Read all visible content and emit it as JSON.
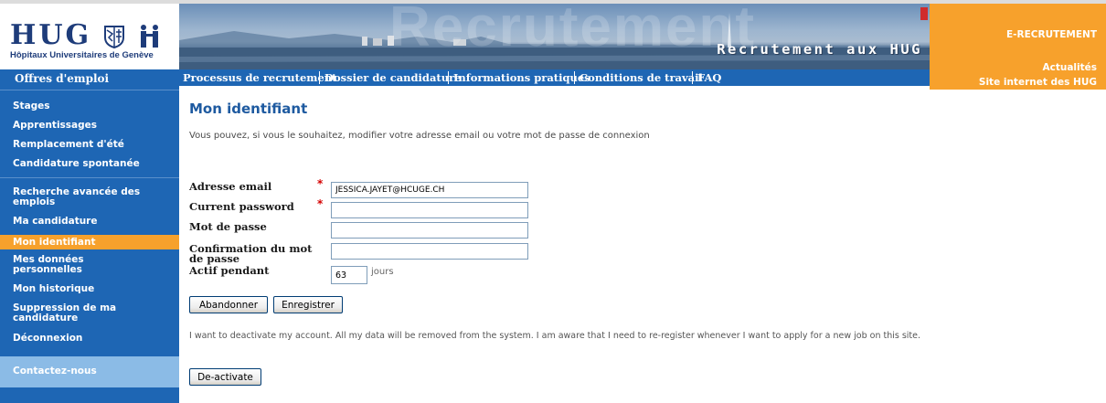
{
  "header": {
    "logo_word": "HUG",
    "logo_subtitle": "Hôpitaux Universitaires de Genève",
    "banner_ghost": "Recrutement",
    "banner_title": "Recrutement aux HUG",
    "right_links": {
      "erecrutement": "E-RECRUTEMENT",
      "actualites": "Actualités",
      "site": "Site internet des HUG"
    },
    "accent_color": "#f7a12c",
    "nav_color": "#1e66b4"
  },
  "nav": {
    "items": [
      "Processus de recrutement",
      "Dossier de candidature",
      "Informations pratiques",
      "Conditions de travail",
      "FAQ"
    ]
  },
  "sidebar": {
    "header": "Offres d'emploi",
    "items": [
      "Stages",
      "Apprentissages",
      "Remplacement d'été",
      "Candidature spontanée",
      "Recherche avancée des emplois",
      "Ma candidature",
      "Mon identifiant",
      "Mes données personnelles",
      "Mon historique",
      "Suppression de ma candidature",
      "Déconnexion"
    ],
    "active": "Mon identifiant",
    "contact": "Contactez-nous"
  },
  "main": {
    "title": "Mon identifiant",
    "intro": "Vous pouvez, si vous le souhaitez, modifier votre adresse email ou votre mot de passe de connexion",
    "required_mark": "*",
    "fields": {
      "email": {
        "label": "Adresse email",
        "value": "JESSICA.JAYET@HCUGE.CH"
      },
      "current_password": {
        "label": "Current password",
        "value": ""
      },
      "password": {
        "label": "Mot de passe",
        "value": ""
      },
      "confirm": {
        "label": "Confirmation du mot de passe",
        "value": ""
      },
      "actif": {
        "label": "Actif pendant",
        "value": "63",
        "unit": "jours"
      }
    },
    "buttons": {
      "cancel": "Abandonner",
      "save": "Enregistrer",
      "deactivate": "De-activate"
    },
    "deactivate_text": "I want to deactivate my account. All my data will be removed from the system. I am aware that I need to re-register whenever I want to apply for a new job on this site."
  }
}
